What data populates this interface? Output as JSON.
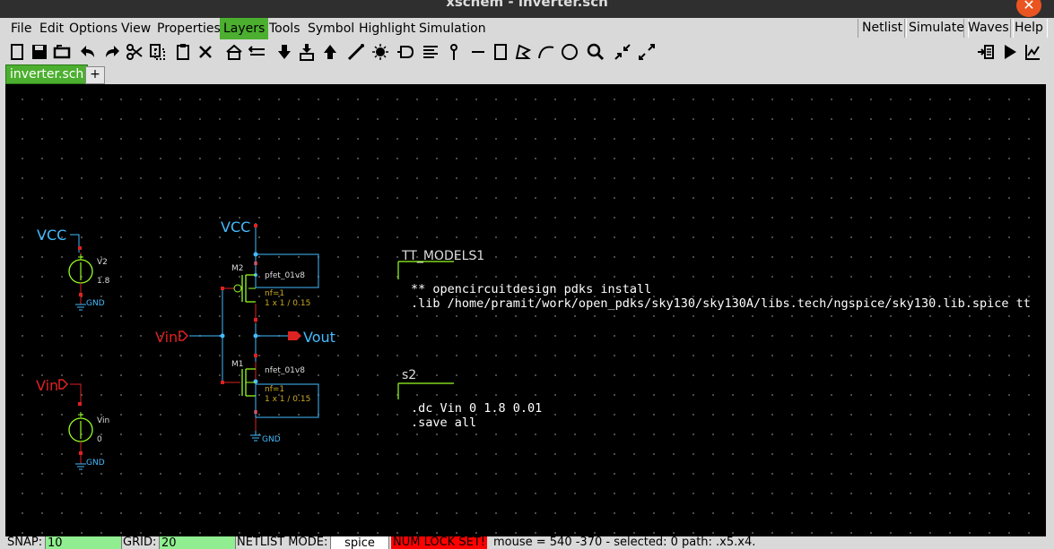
{
  "window": {
    "title": "xschem - inverter.sch",
    "close_glyph": "✕"
  },
  "menu": {
    "items": [
      "File",
      "Edit",
      "Options",
      "View",
      "Properties",
      "Layers",
      "Tools",
      "Symbol",
      "Highlight",
      "Simulation"
    ],
    "active": "Layers",
    "right_buttons": [
      "Netlist",
      "Simulate",
      "Waves",
      "Help"
    ]
  },
  "toolbar": {
    "icons": [
      "new-icon",
      "save-icon",
      "reload-icon",
      "undo-icon",
      "redo-icon",
      "cut-icon",
      "copy-icon",
      "paste-icon",
      "delete-icon",
      "move-icon",
      "swap-icon",
      "push-icon",
      "descend-icon",
      "ascend-icon",
      "wire-icon",
      "snap-icon",
      "symbol-icon",
      "bus-icon",
      "net-label-icon",
      "line-icon",
      "rect-icon",
      "polygon-icon",
      "arc-icon",
      "circle-icon",
      "zoom-icon",
      "zoom-in-icon",
      "zoom-out-icon",
      "netlist-icon",
      "play-icon",
      "waves-icon"
    ]
  },
  "tabs": {
    "active": "inverter.sch",
    "add": "+"
  },
  "schematic": {
    "v2": {
      "net": "VCC",
      "name": "V2",
      "value": "1.8",
      "gnd": "GND"
    },
    "vin_src": {
      "net": "Vin",
      "name": "Vin",
      "value": "0",
      "gnd": "GND"
    },
    "inverter": {
      "vcc": "VCC",
      "input": "Vin",
      "output": "Vout",
      "gnd": "GND",
      "pmos": {
        "inst": "M2",
        "model": "pfet_01v8",
        "nf": "nf=1",
        "size": "1 x 1 / 0.15"
      },
      "nmos": {
        "inst": "M1",
        "model": "nfet_01v8",
        "nf": "nf=1",
        "size": "1 x 1 / 0.15"
      }
    },
    "code1": {
      "name": "TT_MODELS1",
      "line1": "** opencircuitdesign pdks install",
      "line2": ".lib /home/pramit/work/open_pdks/sky130/sky130A/libs.tech/ngspice/sky130.lib.spice tt"
    },
    "code2": {
      "name": "s2",
      "line1": ".dc Vin 0 1.8 0.01",
      "line2": ".save all"
    },
    "colors": {
      "wire": "#44bbff",
      "pin": "#dd2222",
      "green": "#99ff22",
      "params": "#ccaa22"
    }
  },
  "status": {
    "snap_label": "SNAP:",
    "snap_value": "10",
    "grid_label": "GRID:",
    "grid_value": "20",
    "netlist_label": "NETLIST MODE:",
    "netlist_value": "spice",
    "numlock": "NUM LOCK SET!",
    "info": "mouse = 540 -370 - selected: 0 path: .x5.x4."
  }
}
